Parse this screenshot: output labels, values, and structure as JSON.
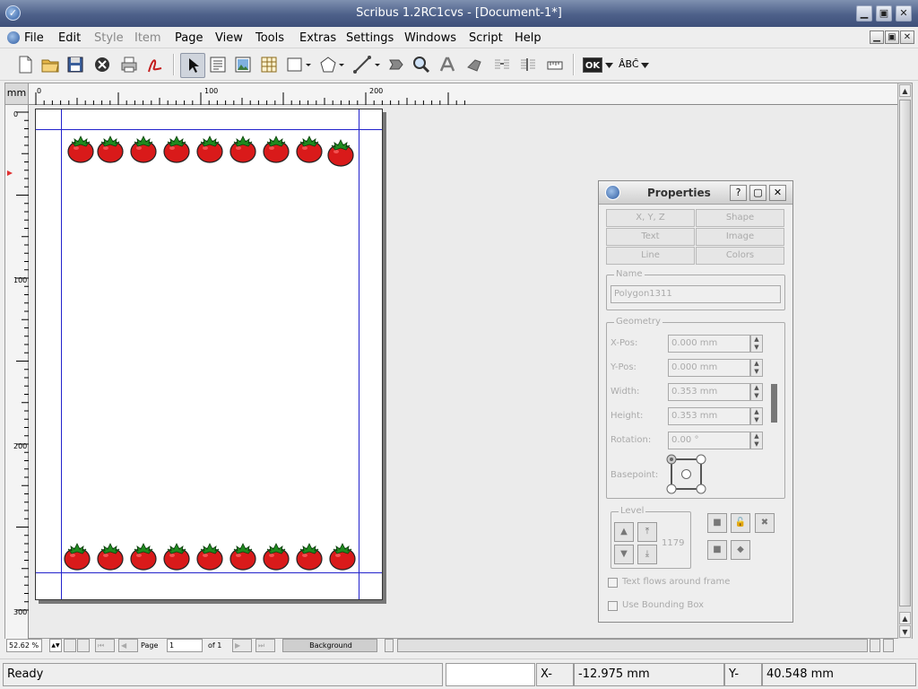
{
  "window": {
    "title": "Scribus 1.2RC1cvs - [Document-1*]",
    "app_icon": "scribus-logo-icon",
    "minimize": "▁",
    "restore": "▣",
    "close": "✕"
  },
  "menu": {
    "items": [
      {
        "label": "File",
        "enabled": true
      },
      {
        "label": "Edit",
        "enabled": true
      },
      {
        "label": "Style",
        "enabled": false
      },
      {
        "label": "Item",
        "enabled": false
      },
      {
        "label": "Page",
        "enabled": true
      },
      {
        "label": "View",
        "enabled": true
      },
      {
        "label": "Tools",
        "enabled": true
      },
      {
        "label": "Extras",
        "enabled": true
      },
      {
        "label": "Settings",
        "enabled": true
      },
      {
        "label": "Windows",
        "enabled": true
      },
      {
        "label": "Script",
        "enabled": true
      },
      {
        "label": "Help",
        "enabled": true
      }
    ]
  },
  "toolbar": {
    "icons": [
      "new-document-icon",
      "open-folder-icon",
      "save-icon",
      "close-document-icon",
      "print-icon",
      "pdf-export-icon",
      "select-arrow-icon",
      "text-frame-icon",
      "image-frame-icon",
      "table-icon",
      "shape-icon",
      "polygon-icon",
      "line-icon",
      "rotate-icon",
      "zoom-icon",
      "edit-text-icon",
      "link-frames-icon",
      "unlink-frames-icon",
      "measure-icon",
      "pdf-tools-icon",
      "spell-check-icon"
    ],
    "ok_label": "OK",
    "spell_label": "ÂBĈ"
  },
  "rulers": {
    "unit": "mm",
    "h_ticks": [
      "0",
      "100",
      "200"
    ],
    "v_ticks": [
      "0",
      "100",
      "200",
      "300"
    ]
  },
  "canvas": {
    "decoration": "tomato",
    "top_row_count": 9,
    "bottom_row_count": 9
  },
  "bottom": {
    "zoom": "52.62 %",
    "page_label": "Page",
    "page_value": "1",
    "page_of": "of 1",
    "layer": "Background"
  },
  "status": {
    "ready": "Ready",
    "xpos_label": "X-Pos:",
    "xpos_value": "-12.975 mm",
    "ypos_label": "Y-Pos:",
    "ypos_value": "40.548 mm"
  },
  "properties": {
    "title": "Properties",
    "help": "?",
    "tabs": [
      "X, Y, Z",
      "Shape",
      "Text",
      "Image",
      "Line",
      "Colors"
    ],
    "name_group": "Name",
    "name_value": "Polygon1311",
    "geometry_group": "Geometry",
    "fields": [
      {
        "label": "X-Pos:",
        "value": "0.000 mm"
      },
      {
        "label": "Y-Pos:",
        "value": "0.000 mm"
      },
      {
        "label": "Width:",
        "value": "0.353 mm"
      },
      {
        "label": "Height:",
        "value": "0.353 mm"
      },
      {
        "label": "Rotation:",
        "value": "0.00 °"
      }
    ],
    "basepoint_label": "Basepoint:",
    "level_group": "Level",
    "level_value": "1179",
    "text_flows": "Text flows around frame",
    "bounding_box": "Use Bounding Box"
  }
}
